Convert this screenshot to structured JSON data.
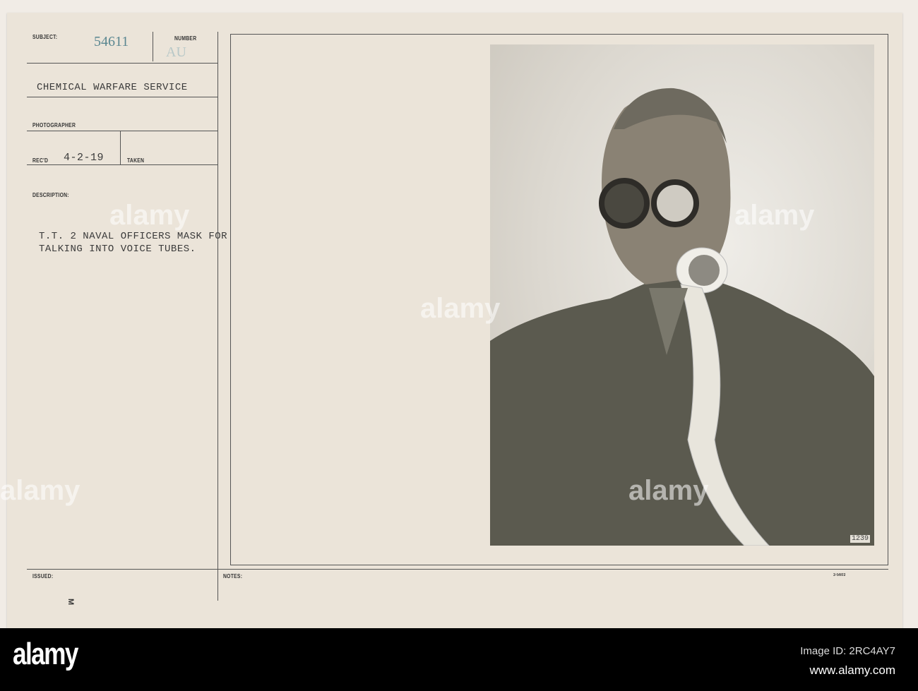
{
  "card": {
    "subject_label": "SUBJECT:",
    "subject_number": "54611",
    "number_label": "NUMBER",
    "number_stamp": "AU",
    "subject_text": "CHEMICAL WARFARE SERVICE",
    "photographer_label": "PHOTOGRAPHER",
    "recd_label": "REC'D",
    "recd_value": "4-2-19",
    "taken_label": "TAKEN",
    "description_label": "DESCRIPTION:",
    "description_lines": [
      "T.T. 2 NAVAL OFFICERS MASK FOR",
      "TALKING INTO VOICE TUBES."
    ],
    "issued_label": "ISSUED:",
    "issued_mark": "M",
    "notes_label": "NOTES:",
    "form_number": "3-5603",
    "photo_number": "1239"
  },
  "footer": {
    "logo": "alamy",
    "image_id": "Image ID: 2RC4AY7",
    "url": "www.alamy.com"
  },
  "watermark": "alamy"
}
